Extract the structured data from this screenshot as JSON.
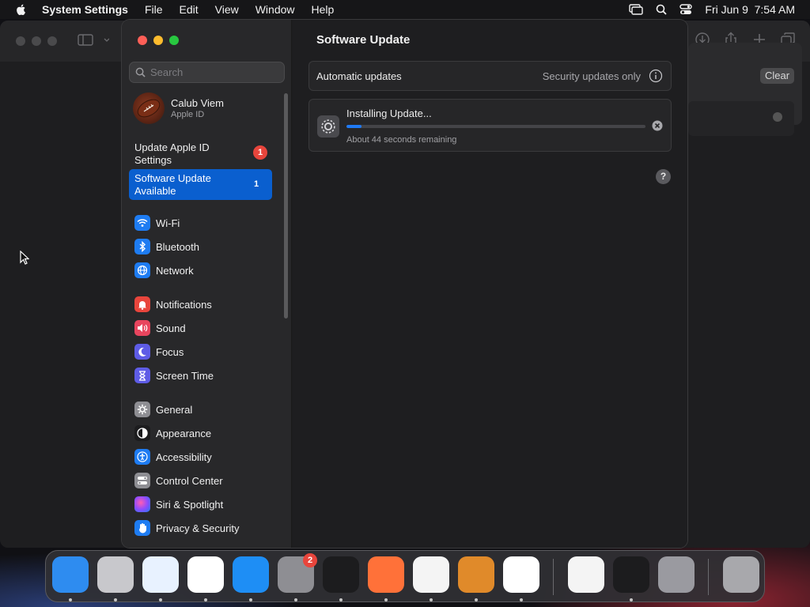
{
  "menubar": {
    "app_name": "System Settings",
    "menus": [
      "File",
      "Edit",
      "View",
      "Window",
      "Help"
    ],
    "datetime": "Fri Jun 9  7:54 AM"
  },
  "background_window": {
    "clear_label": "Clear"
  },
  "sidebar": {
    "search_placeholder": "Search",
    "profile": {
      "name": "Calub Viem",
      "subtitle": "Apple ID"
    },
    "alert": {
      "label": "Update Apple ID Settings",
      "badge": "1"
    },
    "selected": {
      "label": "Software Update Available",
      "badge": "1"
    },
    "items": [
      {
        "label": "Wi-Fi",
        "icon": "wifi-icon",
        "color": "#1e7cf2"
      },
      {
        "label": "Bluetooth",
        "icon": "bluetooth-icon",
        "color": "#1e7cf2"
      },
      {
        "label": "Network",
        "icon": "network-globe-icon",
        "color": "#1e7cf2"
      },
      {
        "label": "Notifications",
        "icon": "notifications-bell-icon",
        "color": "#e8453c"
      },
      {
        "label": "Sound",
        "icon": "sound-speaker-icon",
        "color": "#e8455e"
      },
      {
        "label": "Focus",
        "icon": "focus-moon-icon",
        "color": "#5e5ce6"
      },
      {
        "label": "Screen Time",
        "icon": "screen-time-hourglass-icon",
        "color": "#5e5ce6"
      },
      {
        "label": "General",
        "icon": "general-gear-icon",
        "color": "#8e8e93"
      },
      {
        "label": "Appearance",
        "icon": "appearance-circle-icon",
        "color": "#1c1c1e"
      },
      {
        "label": "Accessibility",
        "icon": "accessibility-icon",
        "color": "#1e7cf2"
      },
      {
        "label": "Control Center",
        "icon": "control-center-icon",
        "color": "#8e8e93"
      },
      {
        "label": "Siri & Spotlight",
        "icon": "siri-icon",
        "color": "#c24bd8"
      },
      {
        "label": "Privacy & Security",
        "icon": "privacy-hand-icon",
        "color": "#1e7cf2"
      }
    ]
  },
  "content": {
    "title": "Software Update",
    "automatic_updates": {
      "label": "Automatic updates",
      "value": "Security updates only"
    },
    "install": {
      "title": "Installing Update...",
      "remaining": "About 44 seconds remaining",
      "progress": 0.05
    },
    "help": "?"
  },
  "dock": {
    "apps": [
      {
        "name": "finder",
        "color": "#2e8cf0"
      },
      {
        "name": "launchpad",
        "color": "#c8c8cc"
      },
      {
        "name": "safari",
        "color": "#e8f2ff"
      },
      {
        "name": "chrome",
        "color": "#ffffff"
      },
      {
        "name": "app-store",
        "color": "#1e8ef5"
      },
      {
        "name": "system-settings",
        "color": "#8e8e93",
        "badge": "2"
      },
      {
        "name": "terminal",
        "color": "#1c1c1e"
      },
      {
        "name": "firefox",
        "color": "#ff7139"
      },
      {
        "name": "textedit",
        "color": "#f4f4f4"
      },
      {
        "name": "garageband",
        "color": "#e08a2a"
      },
      {
        "name": "vscode",
        "color": "#ffffff"
      },
      {
        "name": "visual-studio",
        "color": "#f4f4f4"
      },
      {
        "name": "activity-monitor",
        "color": "#1c1c1e"
      },
      {
        "name": "xcode-instruments",
        "color": "#9a9aa0"
      },
      {
        "name": "trash",
        "color": "#a8a8ac"
      }
    ]
  }
}
